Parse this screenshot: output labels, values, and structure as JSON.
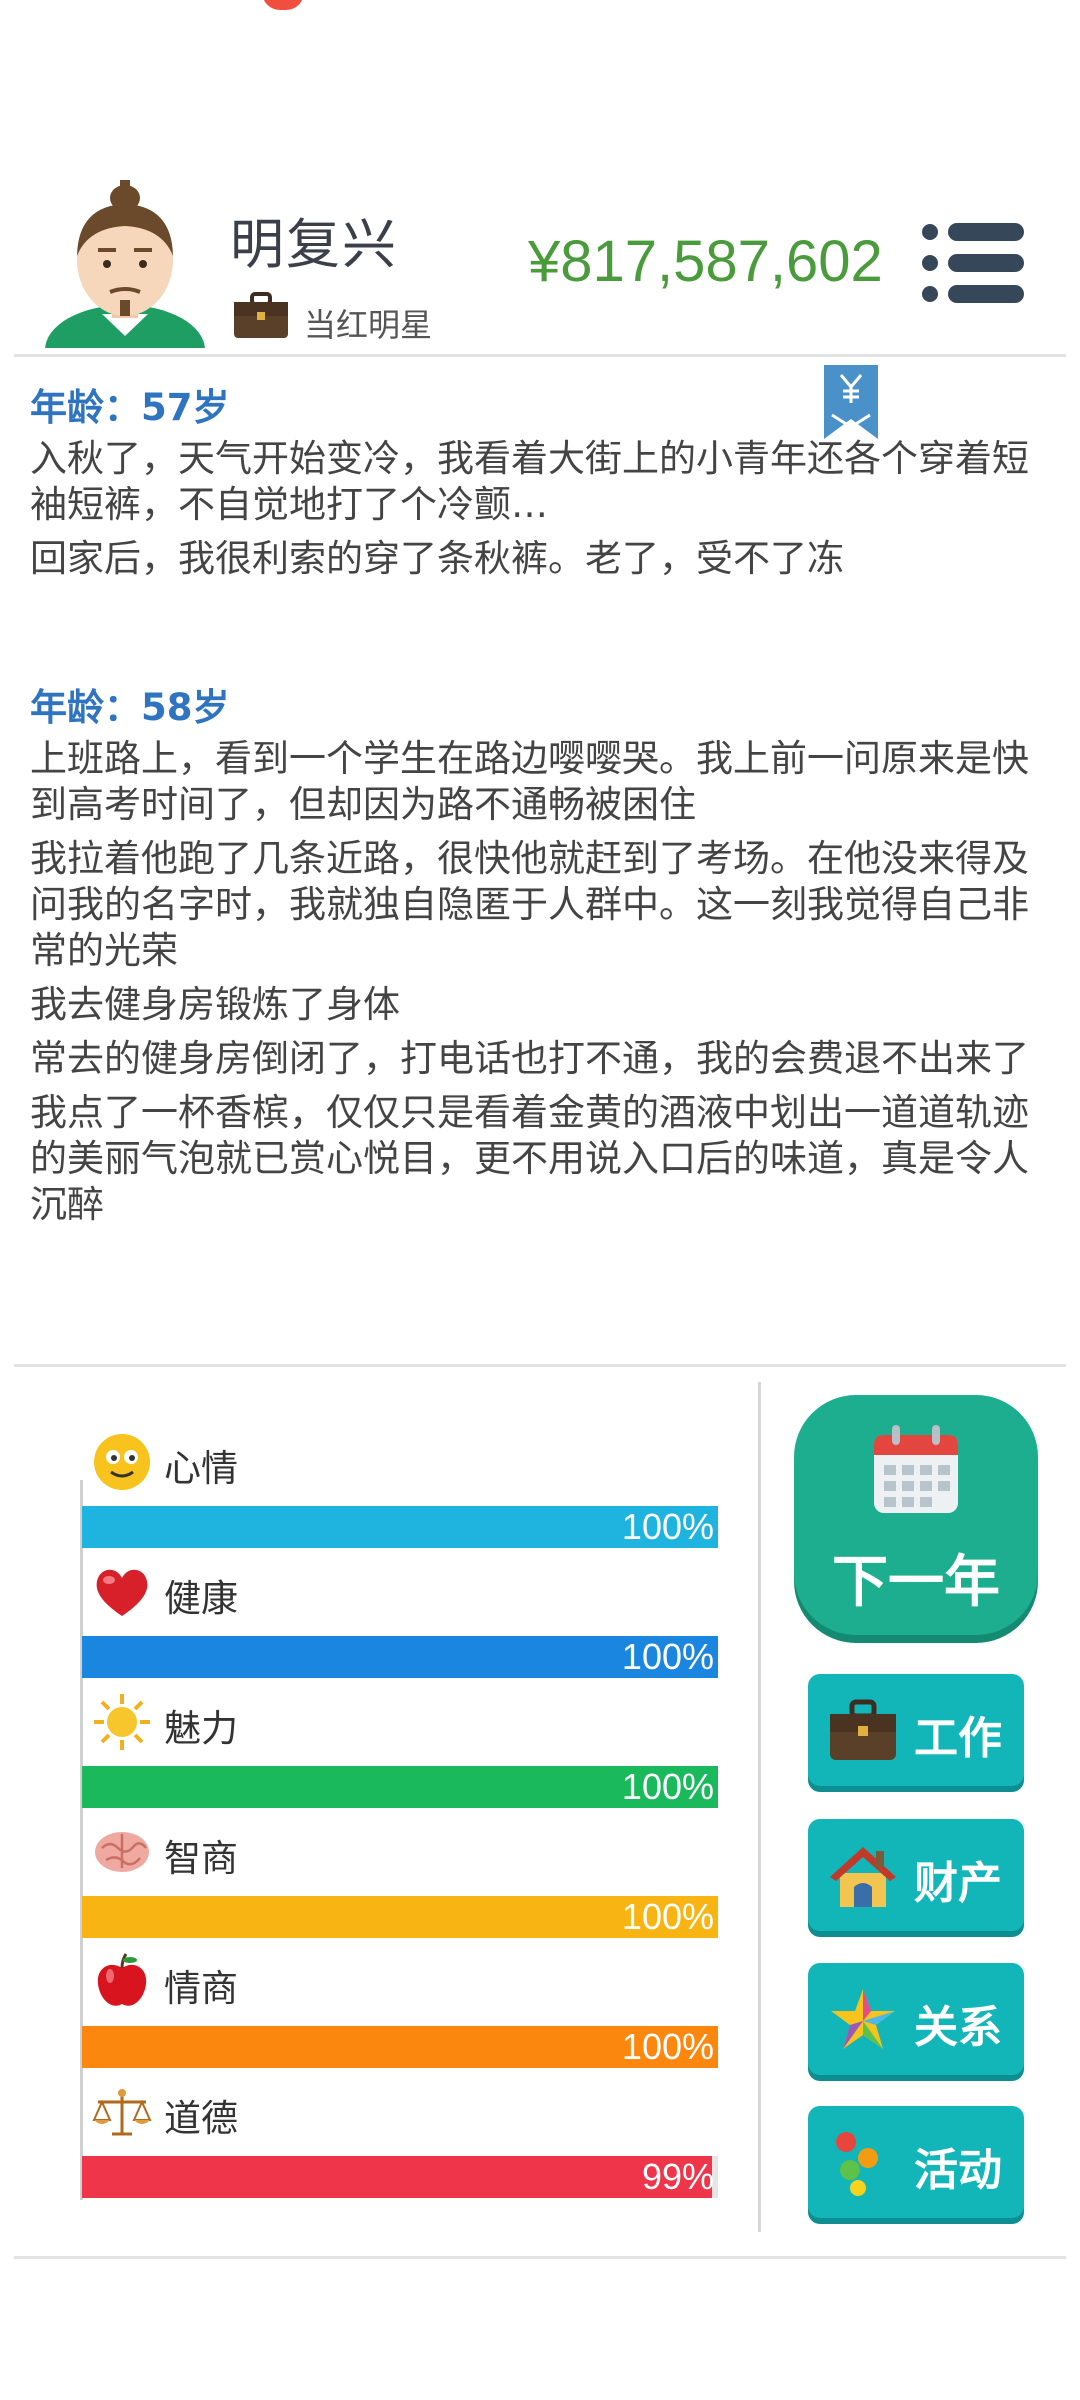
{
  "player": {
    "name": "明复兴",
    "title": "当红明星",
    "money": "¥817,587,602"
  },
  "log": [
    {
      "age": "年龄：57岁",
      "lines": [
        "入秋了，天气开始变冷，我看着大街上的小青年还各个穿着短袖短裤，不自觉地打了个冷颤…",
        "回家后，我很利索的穿了条秋裤。老了，受不了冻"
      ]
    },
    {
      "age": "年龄：58岁",
      "lines": [
        "上班路上，看到一个学生在路边嘤嘤哭。我上前一问原来是快到高考时间了，但却因为路不通畅被困住",
        "我拉着他跑了几条近路，很快他就赶到了考场。在他没来得及问我的名字时，我就独自隐匿于人群中。这一刻我觉得自己非常的光荣",
        "我去健身房锻炼了身体",
        "常去的健身房倒闭了，打电话也打不通，我的会费退不出来了",
        "我点了一杯香槟，仅仅只是看着金黄的酒液中划出一道道轨迹的美丽气泡就已赏心悦目，更不用说入口后的味道，真是令人沉醉"
      ]
    }
  ],
  "stats": [
    {
      "label": "心情",
      "percent": "100%",
      "value": 100,
      "icon": "smiley-icon",
      "color": "#1fb3e0"
    },
    {
      "label": "健康",
      "percent": "100%",
      "value": 100,
      "icon": "heart-icon",
      "color": "#1a86e0"
    },
    {
      "label": "魅力",
      "percent": "100%",
      "value": 100,
      "icon": "sun-icon",
      "color": "#19b95c"
    },
    {
      "label": "智商",
      "percent": "100%",
      "value": 100,
      "icon": "brain-icon",
      "color": "#f8b412"
    },
    {
      "label": "情商",
      "percent": "100%",
      "value": 100,
      "icon": "apple-icon",
      "color": "#fb870e"
    },
    {
      "label": "道德",
      "percent": "99%",
      "value": 99,
      "icon": "scales-icon",
      "color": "#ef3549"
    }
  ],
  "actions": {
    "next_year": "下一年",
    "work": "工作",
    "property": "财产",
    "relations": "关系",
    "activities": "活动"
  },
  "colors": {
    "money": "#4a9b3b",
    "age_heading": "#2f74c0",
    "next_button": "#1cae8f",
    "action_button": "#12b5b8"
  }
}
